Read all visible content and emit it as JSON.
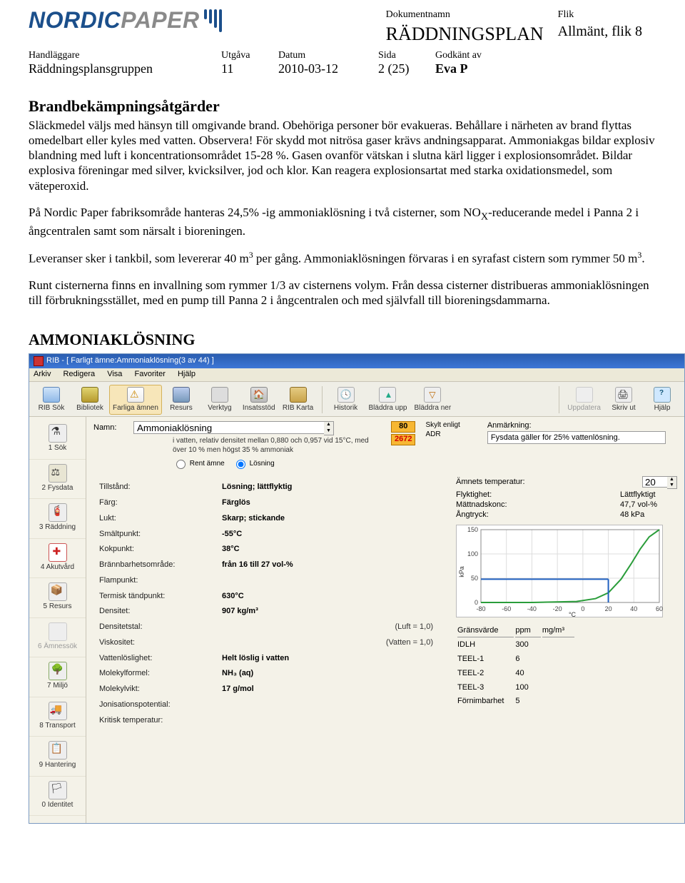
{
  "header": {
    "logo_nordic": "NORDIC",
    "logo_paper": "PAPER",
    "dokumentnamn_label": "Dokumentnamn",
    "dokumentnamn": "RÄDDNINGSPLAN",
    "flik_label": "Flik",
    "flik": "Allmänt, flik 8",
    "handlaggare_label": "Handläggare",
    "handlaggare": "Räddningsplansgruppen",
    "utgava_label": "Utgåva",
    "utgava": "11",
    "datum_label": "Datum",
    "datum": "2010-03-12",
    "sida_label": "Sida",
    "sida": "2 (25)",
    "godkant_label": "Godkänt av",
    "godkant": "Eva P"
  },
  "sections": {
    "title1": "Brandbekämpningsåtgärder",
    "p1": "Släckmedel väljs med hänsyn till omgivande brand. Obehöriga personer bör evakueras. Behållare i närheten av brand flyttas omedelbart eller kyles med vatten. Observera! För skydd mot nitrösa gaser krävs andningsapparat. Ammoniakgas bildar explosiv blandning med luft i koncentrationsområdet 15-28 %. Gasen ovanför vätskan i slutna kärl ligger i explosionsområdet. Bildar explosiva föreningar med silver, kvicksilver, jod och klor. Kan reagera explosionsartat med starka oxidationsmedel, som väteperoxid.",
    "p2a": "På Nordic Paper fabriksområde hanteras 24,5% -ig ammoniaklösning i två cisterner, som NO",
    "p2x": "X",
    "p2b": "-reducerande medel i Panna 2 i ångcentralen samt som närsalt i bioreningen.",
    "p3a": "Leveranser sker i tankbil, som levererar 40 m",
    "p3b": " per gång. Ammoniaklösningen förvaras i en syrafast cistern som rymmer 50 m",
    "p3c": ".",
    "p4": "Runt cisternerna finns en invallning som rymmer 1/3 av cisternens volym. Från dessa cisterner distribueras ammoniaklösningen till förbrukningsstället, med en pump till Panna 2 i ångcentralen och med självfall till bioreningsdammarna.",
    "title2": "AMMONIAKLÖSNING"
  },
  "app": {
    "titlebar": "RIB - [ Farligt ämne:Ammoniaklösning(3 av 44) ]",
    "menus": [
      "Arkiv",
      "Redigera",
      "Visa",
      "Favoriter",
      "Hjälp"
    ],
    "toolbar": [
      {
        "name": "rib-sok",
        "label": "RIB Sök",
        "icon": "i-search"
      },
      {
        "name": "bibliotek",
        "label": "Bibliotek",
        "icon": "i-book"
      },
      {
        "name": "farliga",
        "label": "Farliga ämnen",
        "icon": "i-warn",
        "sel": true
      },
      {
        "name": "resurs",
        "label": "Resurs",
        "icon": "i-db"
      },
      {
        "name": "verktyg",
        "label": "Verktyg",
        "icon": "i-tools"
      },
      {
        "name": "insatsstod",
        "label": "Insatsstöd",
        "icon": "i-support"
      },
      {
        "name": "rib-karta",
        "label": "RIB Karta",
        "icon": "i-map"
      }
    ],
    "toolbar2": [
      {
        "name": "historik",
        "label": "Historik",
        "icon": "i-hist"
      },
      {
        "name": "bladdra-upp",
        "label": "Bläddra upp",
        "icon": "i-up"
      },
      {
        "name": "bladdra-ner",
        "label": "Bläddra ner",
        "icon": "i-down"
      }
    ],
    "toolbar3": [
      {
        "name": "uppdatera",
        "label": "Uppdatera",
        "icon": "i-update",
        "dim": true
      },
      {
        "name": "skriv-ut",
        "label": "Skriv ut",
        "icon": "i-print"
      },
      {
        "name": "hjalp",
        "label": "Hjälp",
        "icon": "i-help"
      }
    ],
    "sidebar": [
      {
        "name": "sok",
        "label": "1 Sök",
        "icon": "i-flask"
      },
      {
        "name": "fysdata",
        "label": "2 Fysdata",
        "icon": "i-fys"
      },
      {
        "name": "raddning",
        "label": "3 Räddning",
        "icon": "i-resc"
      },
      {
        "name": "akutvard",
        "label": "4 Akutvård",
        "icon": "i-med"
      },
      {
        "name": "resurs2",
        "label": "5 Resurs",
        "icon": "i-res"
      },
      {
        "name": "amnessok",
        "label": "6 Ämnessök",
        "icon": "i-sok2",
        "dim": true
      },
      {
        "name": "miljo",
        "label": "7 Miljö",
        "icon": "i-tree"
      },
      {
        "name": "transport",
        "label": "8 Transport",
        "icon": "i-trans"
      },
      {
        "name": "hantering",
        "label": "9 Hantering",
        "icon": "i-hand"
      },
      {
        "name": "identitet",
        "label": "0 Identitet",
        "icon": "i-flag"
      }
    ],
    "name_label": "Namn:",
    "name_value": "Ammoniaklösning",
    "subdesc": "i vatten, relativ densitet mellan 0,880 och 0,957 vid 15°C, med över 10 % men högst 35 % ammoniak",
    "adr80": "80",
    "adr2672": "2672",
    "adr_label1": "Skylt enligt",
    "adr_label2": "ADR",
    "anm_label": "Anmärkning:",
    "anm_value": "Fysdata gäller för 25% vattenlösning.",
    "radio_rent": "Rent ämne",
    "radio_losning": "Lösning",
    "props_left": [
      {
        "key": "Tillstånd:",
        "val": "Lösning; lättflyktig"
      },
      {
        "key": "Färg:",
        "val": "Färglös"
      },
      {
        "key": "Lukt:",
        "val": "Skarp; stickande"
      },
      {
        "key": "Smältpunkt:",
        "val": "-55°C"
      },
      {
        "key": "Kokpunkt:",
        "val": "38°C"
      },
      {
        "key": "Brännbarhetsområde:",
        "val": "från 16 till 27 vol-%"
      },
      {
        "key": "Flampunkt:",
        "val": ""
      },
      {
        "key": "Termisk tändpunkt:",
        "val": "630°C"
      },
      {
        "key": "Densitet:",
        "val": "907 kg/m³"
      },
      {
        "key": "Densitetstal:",
        "val": "",
        "right": "(Luft = 1,0)"
      },
      {
        "key": "Viskositet:",
        "val": "",
        "right": "(Vatten = 1,0)"
      },
      {
        "key": "Vattenlöslighet:",
        "val": "Helt löslig i vatten"
      },
      {
        "key": "Molekylformel:",
        "val": "NH₃ (aq)"
      },
      {
        "key": "Molekylvikt:",
        "val": "17 g/mol"
      },
      {
        "key": "Jonisationspotential:",
        "val": ""
      },
      {
        "key": "Kritisk temperatur:",
        "val": ""
      }
    ],
    "right_block": {
      "temp_label": "Ämnets temperatur:",
      "temp_value": "20",
      "rows": [
        {
          "key": "Flyktighet:",
          "val": "Lättflyktigt"
        },
        {
          "key": "Mättnadskonc:",
          "val": "47,7 vol-%"
        },
        {
          "key": "Ångtryck:",
          "val": "48 kPa"
        }
      ]
    },
    "limits": {
      "header": [
        "Gränsvärde",
        "ppm",
        "mg/m³"
      ],
      "rows": [
        {
          "k": "IDLH",
          "a": "300",
          "b": ""
        },
        {
          "k": "TEEL-1",
          "a": "6",
          "b": ""
        },
        {
          "k": "TEEL-2",
          "a": "40",
          "b": ""
        },
        {
          "k": "TEEL-3",
          "a": "100",
          "b": ""
        },
        {
          "k": "Förnimbarhet",
          "a": "5",
          "b": ""
        }
      ]
    }
  },
  "chart_data": {
    "type": "line",
    "title": "",
    "xlabel": "°C",
    "ylabel": "kPa",
    "xlim": [
      -80,
      60
    ],
    "ylim": [
      0,
      150
    ],
    "xticks": [
      -80,
      -60,
      -40,
      -20,
      0,
      20,
      40,
      60
    ],
    "yticks": [
      0,
      50,
      100,
      150
    ],
    "series": [
      {
        "name": "Ångtryck (grön)",
        "color": "#2a9d3a",
        "x": [
          -80,
          -40,
          -5,
          10,
          20,
          30,
          38,
          45,
          52,
          60
        ],
        "y": [
          0,
          0,
          2,
          8,
          20,
          48,
          80,
          110,
          135,
          150
        ]
      },
      {
        "name": "Referens (blå)",
        "color": "#2060c0",
        "x": [
          20,
          20
        ],
        "y": [
          0,
          48
        ]
      },
      {
        "name": "Tryckref (blå)",
        "color": "#2060c0",
        "x": [
          -80,
          20
        ],
        "y": [
          48,
          48
        ]
      }
    ]
  }
}
